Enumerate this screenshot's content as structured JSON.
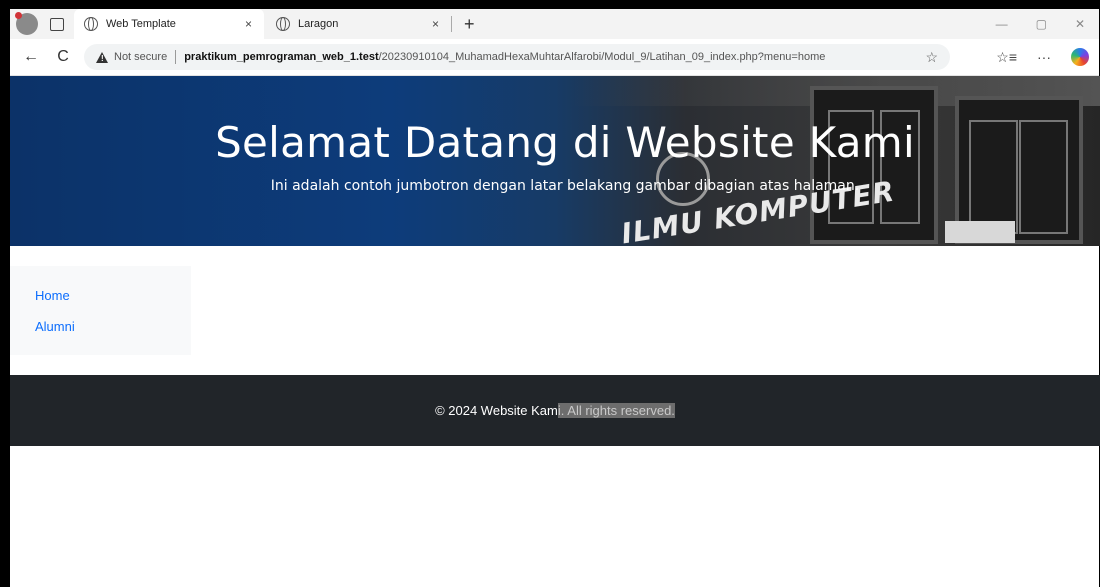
{
  "browser": {
    "tabs": [
      {
        "title": "Web Template",
        "active": true
      },
      {
        "title": "Laragon",
        "active": false
      }
    ],
    "new_tab_symbol": "+",
    "close_symbol": "×",
    "nav": {
      "back": "←",
      "reload": "C"
    },
    "security_label": "Not secure",
    "url_host": "praktikum_pemrograman_web_1.test",
    "url_path": "/20230910104_MuhamadHexaMuhtarAlfarobi/Modul_9/Latihan_09_index.php?menu=home",
    "window_controls": {
      "minimize": "—",
      "restore": "▢",
      "close": "✕"
    },
    "toolbar_icons": {
      "favorite": "☆",
      "favorites": "☆≡",
      "more": "···"
    }
  },
  "jumbotron": {
    "title": "Selamat Datang di Website Kami",
    "subtitle": "Ini adalah contoh jumbotron dengan latar belakang gambar dibagian atas halaman.",
    "background_sign": "ILMU KOMPUTER"
  },
  "sidebar": {
    "items": [
      {
        "label": "Home"
      },
      {
        "label": "Alumni"
      }
    ]
  },
  "footer": {
    "text_plain": "© 2024 Website Kam",
    "text_selected": "i. All rights reserved."
  },
  "colors": {
    "link": "#0d6efd",
    "footer_bg": "#212529",
    "sidebar_bg": "#f8f9fa",
    "jumbotron_blue": "#0d3c7b"
  }
}
